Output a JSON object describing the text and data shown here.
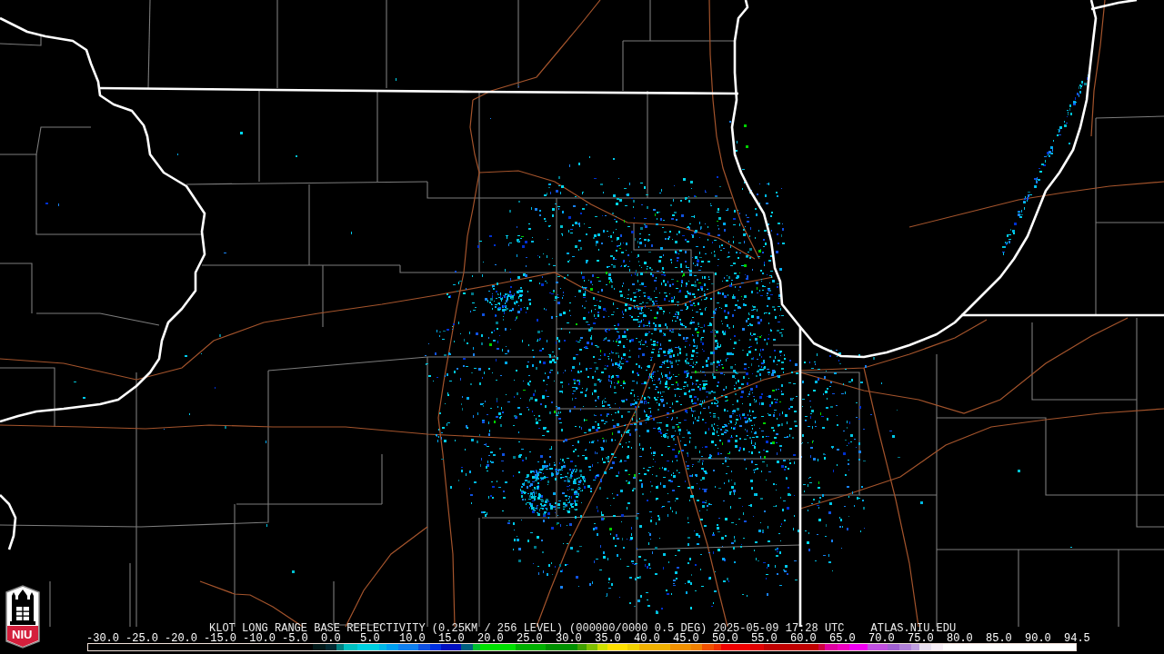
{
  "logo": {
    "text": "NIU"
  },
  "product": {
    "title": "KLOT LONG RANGE BASE REFLECTIVITY (0.25KM / 256 LEVEL) (000000/0000 0.5 DEG) 2025-05-09 17:28 UTC",
    "source": "ATLAS.NIU.EDU"
  },
  "scale": {
    "labels": [
      "-30.0",
      "-25.0",
      "-20.0",
      "-15.0",
      "-10.0",
      "-5.0",
      "0.0",
      "5.0",
      "10.0",
      "15.0",
      "20.0",
      "25.0",
      "30.0",
      "35.0",
      "40.0",
      "45.0",
      "50.0",
      "55.0",
      "60.0",
      "65.0",
      "70.0",
      "75.0",
      "80.0",
      "85.0",
      "90.0",
      "94.5"
    ]
  }
}
